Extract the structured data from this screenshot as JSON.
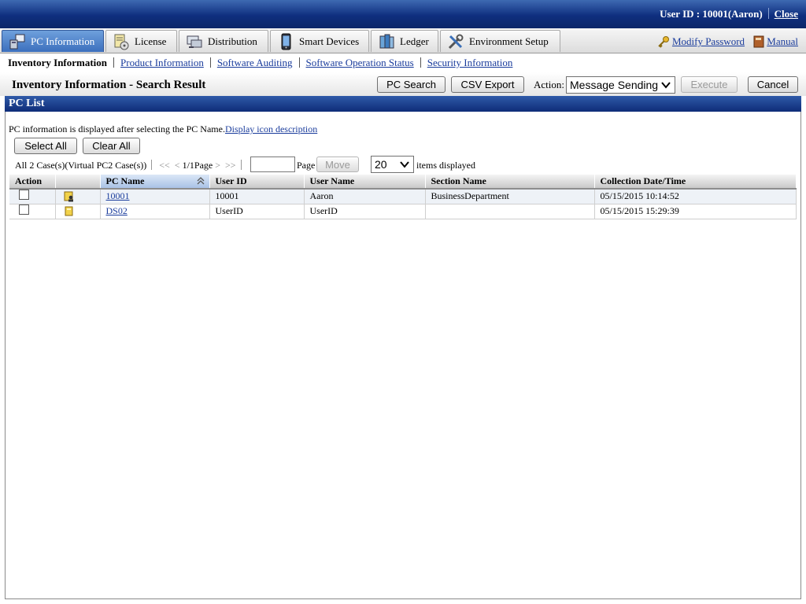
{
  "header": {
    "user_label": "User ID : 10001(Aaron)",
    "close_label": "Close"
  },
  "tabs": [
    {
      "label": "PC Information",
      "icon": "pc-info-icon",
      "active": true
    },
    {
      "label": "License",
      "icon": "license-icon"
    },
    {
      "label": "Distribution",
      "icon": "distribution-icon"
    },
    {
      "label": "Smart Devices",
      "icon": "smart-device-icon"
    },
    {
      "label": "Ledger",
      "icon": "ledger-icon"
    },
    {
      "label": "Environment Setup",
      "icon": "tools-icon"
    }
  ],
  "top_links": {
    "modify_password": "Modify Password",
    "manual": "Manual"
  },
  "submenu": {
    "current": "Inventory Information",
    "links": [
      "Product Information",
      "Software Auditing",
      "Software Operation Status",
      "Security Information"
    ]
  },
  "titlebar": {
    "title": "Inventory Information - Search Result",
    "pc_search": "PC Search",
    "csv_export": "CSV Export",
    "action_label": "Action:",
    "action_value": "Message Sending",
    "execute": "Execute",
    "cancel": "Cancel"
  },
  "panel": {
    "title": "PC List",
    "note": "PC information is displayed after selecting the PC Name.",
    "note_link": "Display icon description",
    "select_all": "Select All",
    "clear_all": "Clear All",
    "case_count": "All 2 Case(s)(Virtual PC2 Case(s))",
    "first": "<<",
    "prev": "<",
    "page_info": "1/1Page",
    "next": ">",
    "last": ">>",
    "page_label": "Page",
    "move": "Move",
    "per_page": "20",
    "items_label": "items displayed"
  },
  "table": {
    "columns": [
      "Action",
      "",
      "PC Name",
      "User ID",
      "User Name",
      "Section Name",
      "Collection Date/Time"
    ],
    "rows": [
      {
        "pc_name": "10001",
        "user_id": "10001",
        "user_name": "Aaron",
        "section": "BusinessDepartment",
        "collected": "05/15/2015 10:14:52",
        "icon": "pc-user-icon"
      },
      {
        "pc_name": "DS02",
        "user_id": "UserID",
        "user_name": "UserID",
        "section": "",
        "collected": "05/15/2015 15:29:39",
        "icon": "pc-icon"
      }
    ]
  }
}
